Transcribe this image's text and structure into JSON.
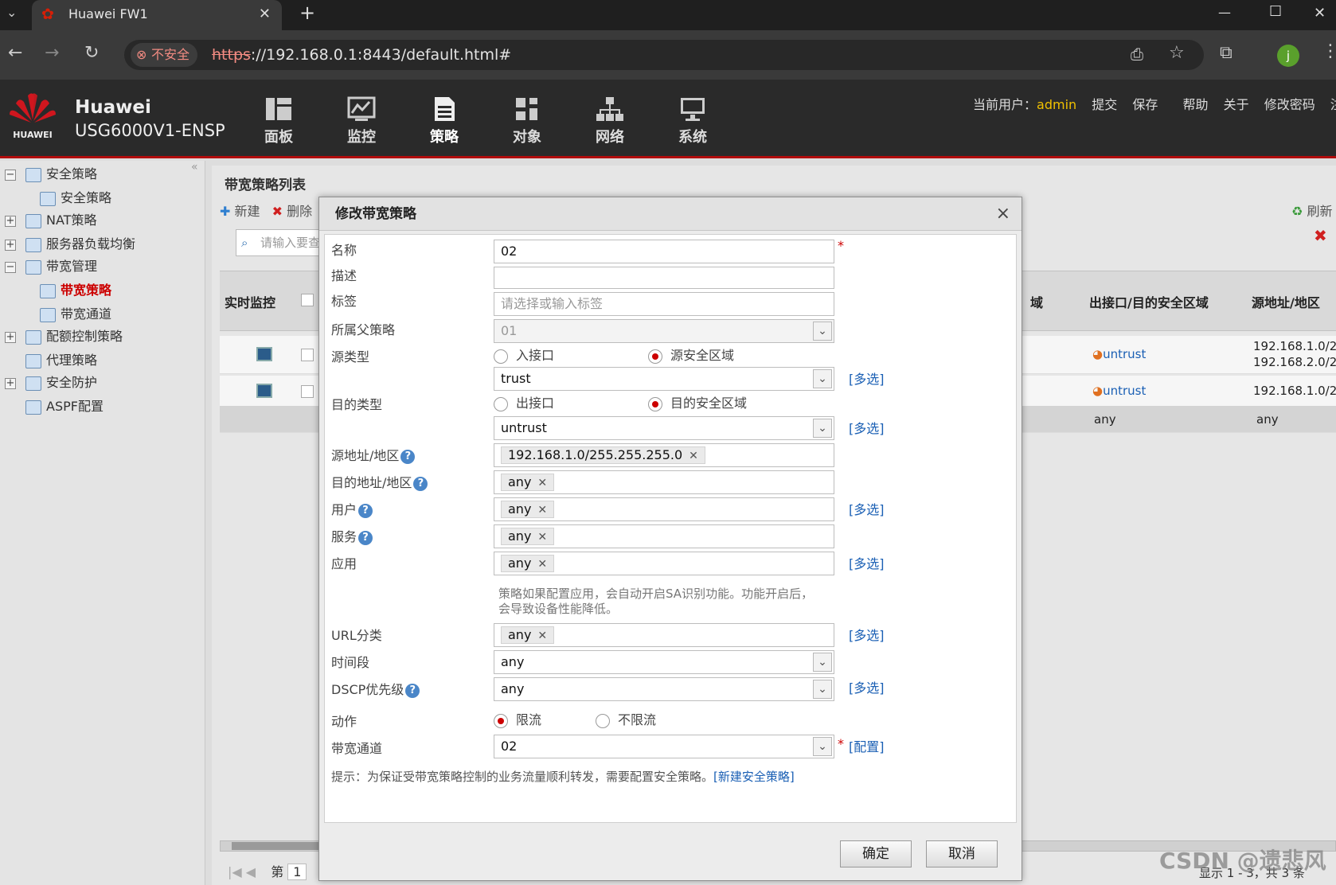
{
  "browser": {
    "tab_title": "Huawei FW1",
    "new_tab": "+",
    "insecure_label": "不安全",
    "url_scheme": "https",
    "url_rest": "://192.168.0.1:8443/default.html#",
    "window_controls": [
      "—",
      "☐",
      "✕"
    ]
  },
  "app": {
    "brand_name": "Huawei",
    "brand_model": "USG6000V1-ENSP",
    "logo_text": "HUAWEI",
    "nav": [
      {
        "label": "面板",
        "icon": "dashboard-icon"
      },
      {
        "label": "监控",
        "icon": "monitor-icon"
      },
      {
        "label": "策略",
        "icon": "policy-icon"
      },
      {
        "label": "对象",
        "icon": "object-icon"
      },
      {
        "label": "网络",
        "icon": "network-icon"
      },
      {
        "label": "系统",
        "icon": "system-icon"
      }
    ],
    "active_nav": "策略",
    "top_links": {
      "current_user_label": "当前用户：",
      "current_user": "admin",
      "submit": "提交",
      "save": "保存",
      "help": "帮助",
      "about": "关于",
      "change_password": "修改密码",
      "logout": "注销"
    }
  },
  "sidebar": {
    "items": [
      {
        "label": "安全策略",
        "level": 0,
        "expand": "−"
      },
      {
        "label": "安全策略",
        "level": 1
      },
      {
        "label": "NAT策略",
        "level": 0,
        "expand": "+"
      },
      {
        "label": "服务器负载均衡",
        "level": 0,
        "expand": "+"
      },
      {
        "label": "带宽管理",
        "level": 0,
        "expand": "−"
      },
      {
        "label": "带宽策略",
        "level": 1,
        "active": true
      },
      {
        "label": "带宽通道",
        "level": 1
      },
      {
        "label": "配额控制策略",
        "level": 0,
        "expand": "+"
      },
      {
        "label": "代理策略",
        "level": 0
      },
      {
        "label": "安全防护",
        "level": 0,
        "expand": "+"
      },
      {
        "label": "ASPF配置",
        "level": 0
      }
    ]
  },
  "main": {
    "title": "带宽策略列表",
    "toolbar": {
      "new": "新建",
      "delete": "删除",
      "refresh": "刷新"
    },
    "search_placeholder": "请输入要查",
    "table": {
      "headers": [
        "实时监控",
        "域",
        "出接口/目的安全区域",
        "源地址/地区"
      ],
      "rows": [
        {
          "zone": "untrust",
          "src": "192.168.1.0/2.",
          "src2": "192.168.2.0/2."
        },
        {
          "zone": "untrust",
          "src": "192.168.1.0/2."
        },
        {
          "zone": "any",
          "src": "any"
        }
      ]
    },
    "pager": {
      "page_label": "第",
      "page": "1",
      "summary": "显示 1 - 3，共 3 条"
    }
  },
  "dialog": {
    "title": "修改带宽策略",
    "close": "×",
    "fields": {
      "name_label": "名称",
      "name_value": "02",
      "desc_label": "描述",
      "desc_value": "",
      "tag_label": "标签",
      "tag_placeholder": "请选择或输入标签",
      "parent_label": "所属父策略",
      "parent_value": "01",
      "src_type_label": "源类型",
      "src_opt1": "入接口",
      "src_opt2": "源安全区域",
      "src_zone_value": "trust",
      "dst_type_label": "目的类型",
      "dst_opt1": "出接口",
      "dst_opt2": "目的安全区域",
      "dst_zone_value": "untrust",
      "src_addr_label": "源地址/地区",
      "src_addr_value": "192.168.1.0/255.255.255.0",
      "dst_addr_label": "目的地址/地区",
      "dst_addr_value": "any",
      "user_label": "用户",
      "user_value": "any",
      "service_label": "服务",
      "service_value": "any",
      "app_label": "应用",
      "app_value": "any",
      "app_note": "策略如果配置应用，会自动开启SA识别功能。功能开启后，会导致设备性能降低。",
      "url_label": "URL分类",
      "url_value": "any",
      "time_label": "时间段",
      "time_value": "any",
      "dscp_label": "DSCP优先级",
      "dscp_value": "any",
      "action_label": "动作",
      "action_opt1": "限流",
      "action_opt2": "不限流",
      "channel_label": "带宽通道",
      "channel_value": "02"
    },
    "multi_select": "[多选]",
    "config_link": "[配置]",
    "help_mark": "?",
    "required_mark": "*",
    "hint_text": "提示：为保证受带宽策略控制的业务流量顺利转发，需要配置安全策略。",
    "hint_link": "[新建安全策略]",
    "ok": "确定",
    "cancel": "取消"
  },
  "watermark": "CSDN @遗悲风"
}
